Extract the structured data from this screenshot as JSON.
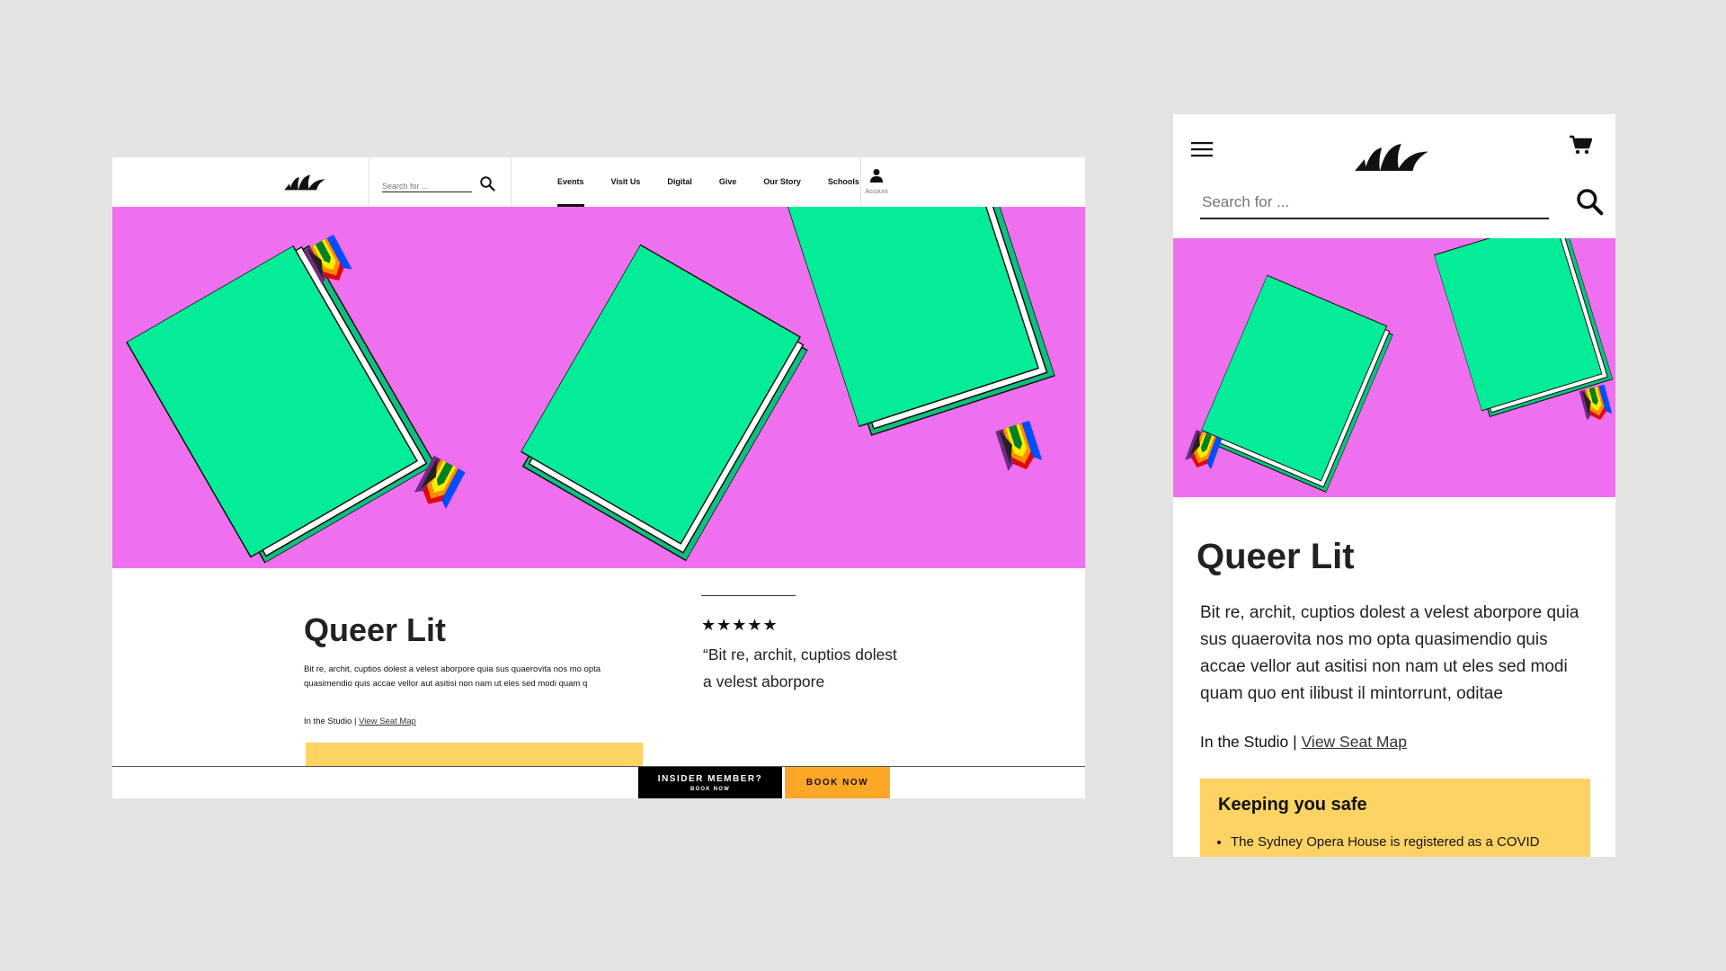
{
  "desktop": {
    "header": {
      "search_placeholder": "Search for ...",
      "nav": [
        {
          "label": "Events",
          "active": true
        },
        {
          "label": "Visit Us"
        },
        {
          "label": "Digital"
        },
        {
          "label": "Give"
        },
        {
          "label": "Our Story"
        },
        {
          "label": "Schools"
        }
      ],
      "account_label": "Account"
    },
    "event": {
      "title": "Queer Lit",
      "description": "Bit re, archit, cuptios dolest a velest aborpore quia sus quaerovita nos mo opta quasimendio quis accae vellor aut asitisi non nam ut eles sed modi quam q",
      "venue": "In the Studio",
      "venue_sep": "|",
      "seat_map_link": "View Seat Map"
    },
    "review": {
      "stars": "★★★★★",
      "rating": 5,
      "quote": "“Bit re, archit, cuptios dolest a velest aborpore"
    },
    "footer_bar": {
      "insider_label": "INSIDER MEMBER?",
      "insider_sub": "BOOK NOW",
      "book_label": "BOOK NOW"
    }
  },
  "mobile": {
    "search_placeholder": "Search for ...",
    "event": {
      "title": "Queer Lit",
      "description": "Bit re, archit, cuptios dolest a velest aborpore quia sus quaerovita nos mo opta quasimendio quis accae vellor aut asitisi non nam ut eles sed modi quam quo ent ilibust il mintorrunt, oditae",
      "venue": "In the Studio",
      "venue_sep": "|",
      "seat_map_link": "View Seat Map"
    },
    "safety": {
      "title": "Keeping you safe",
      "items": [
        "The Sydney Opera House is registered as a COVID"
      ]
    }
  },
  "colors": {
    "background": "#e4e4e2",
    "hero_bg": "#ee70ee",
    "book_green": "#05ec98",
    "book_dark_green": "#0ebf7f",
    "yellow_panel": "#fdd463",
    "book_now_orange": "#fca826",
    "insider_black": "#000000"
  },
  "icons": {
    "logo": "opera-house-logo",
    "search": "search-icon",
    "account": "user-icon",
    "menu": "hamburger-menu-icon",
    "cart": "cart-icon",
    "bookmark": "pride-flag-ribbon"
  }
}
